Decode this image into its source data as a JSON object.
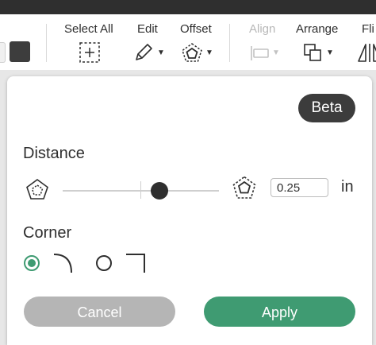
{
  "toolbar": {
    "select_all_label": "Select All",
    "edit_label": "Edit",
    "offset_label": "Offset",
    "align_label": "Align",
    "arrange_label": "Arrange",
    "flip_label": "Fli",
    "icons": {
      "select_all": "dashed-square-plus-icon",
      "edit": "pencil-icon",
      "offset": "offset-pentagon-icon",
      "align": "align-icon",
      "arrange": "arrange-icon",
      "flip": "flip-icon"
    }
  },
  "offset_panel": {
    "beta_badge": "Beta",
    "distance_label": "Distance",
    "distance_value": "0.25",
    "distance_unit": "in",
    "distance_slider_fraction": 0.62,
    "corner_label": "Corner",
    "corner_options": [
      {
        "name": "rounded",
        "selected": true
      },
      {
        "name": "square",
        "selected": false
      }
    ],
    "cancel_label": "Cancel",
    "apply_label": "Apply"
  },
  "colors": {
    "accent": "#3f9b72",
    "cancel": "#b5b5b5",
    "dark": "#2f2f2f"
  }
}
